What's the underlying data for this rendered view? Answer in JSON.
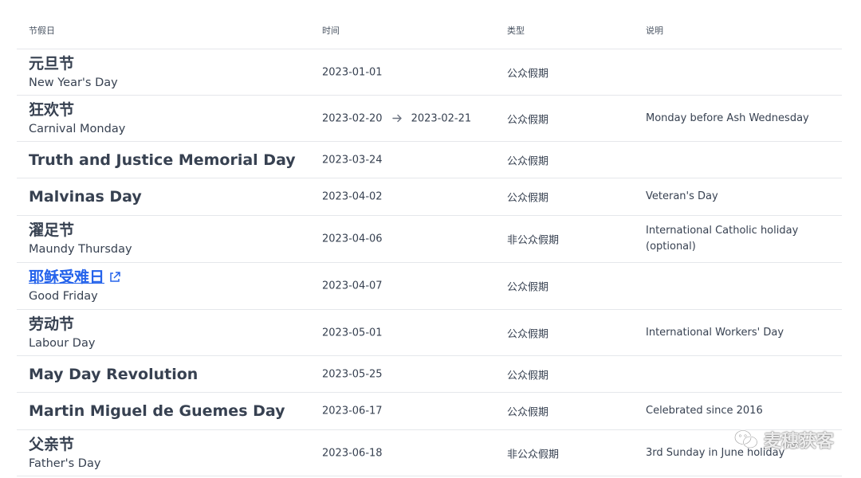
{
  "header": {
    "name": "节假日",
    "date": "时间",
    "type": "类型",
    "desc": "说明"
  },
  "rows": [
    {
      "cn": "元旦节",
      "en": "New Year's Day",
      "date": "2023-01-01",
      "type": "公众假期",
      "desc": ""
    },
    {
      "cn": "狂欢节",
      "en": "Carnival Monday",
      "date": "2023-02-20",
      "date_end": "2023-02-21",
      "type": "公众假期",
      "desc": "Monday before Ash Wednesday"
    },
    {
      "name": "Truth and Justice Memorial Day",
      "date": "2023-03-24",
      "type": "公众假期",
      "desc": ""
    },
    {
      "name": "Malvinas Day",
      "date": "2023-04-02",
      "type": "公众假期",
      "desc": "Veteran's Day"
    },
    {
      "cn": "濯足节",
      "en": "Maundy Thursday",
      "date": "2023-04-06",
      "type": "非公众假期",
      "desc": "International Catholic holiday (optional)"
    },
    {
      "cn": "耶稣受难日",
      "en": "Good Friday",
      "date": "2023-04-07",
      "type": "公众假期",
      "desc": "",
      "link": true
    },
    {
      "cn": "劳动节",
      "en": "Labour Day",
      "date": "2023-05-01",
      "type": "公众假期",
      "desc": "International Workers' Day"
    },
    {
      "name": "May Day Revolution",
      "date": "2023-05-25",
      "type": "公众假期",
      "desc": ""
    },
    {
      "name": "Martin Miguel de Guemes Day",
      "date": "2023-06-17",
      "type": "公众假期",
      "desc": "Celebrated since 2016"
    },
    {
      "cn": "父亲节",
      "en": "Father's Day",
      "date": "2023-06-18",
      "type": "非公众假期",
      "desc": "3rd Sunday in June holiday"
    }
  ],
  "watermark": {
    "text": "麦穗获客",
    "icon": "wechat-icon"
  },
  "colors": {
    "text": "#374151",
    "link": "#2563eb",
    "border": "#e5e7eb"
  }
}
